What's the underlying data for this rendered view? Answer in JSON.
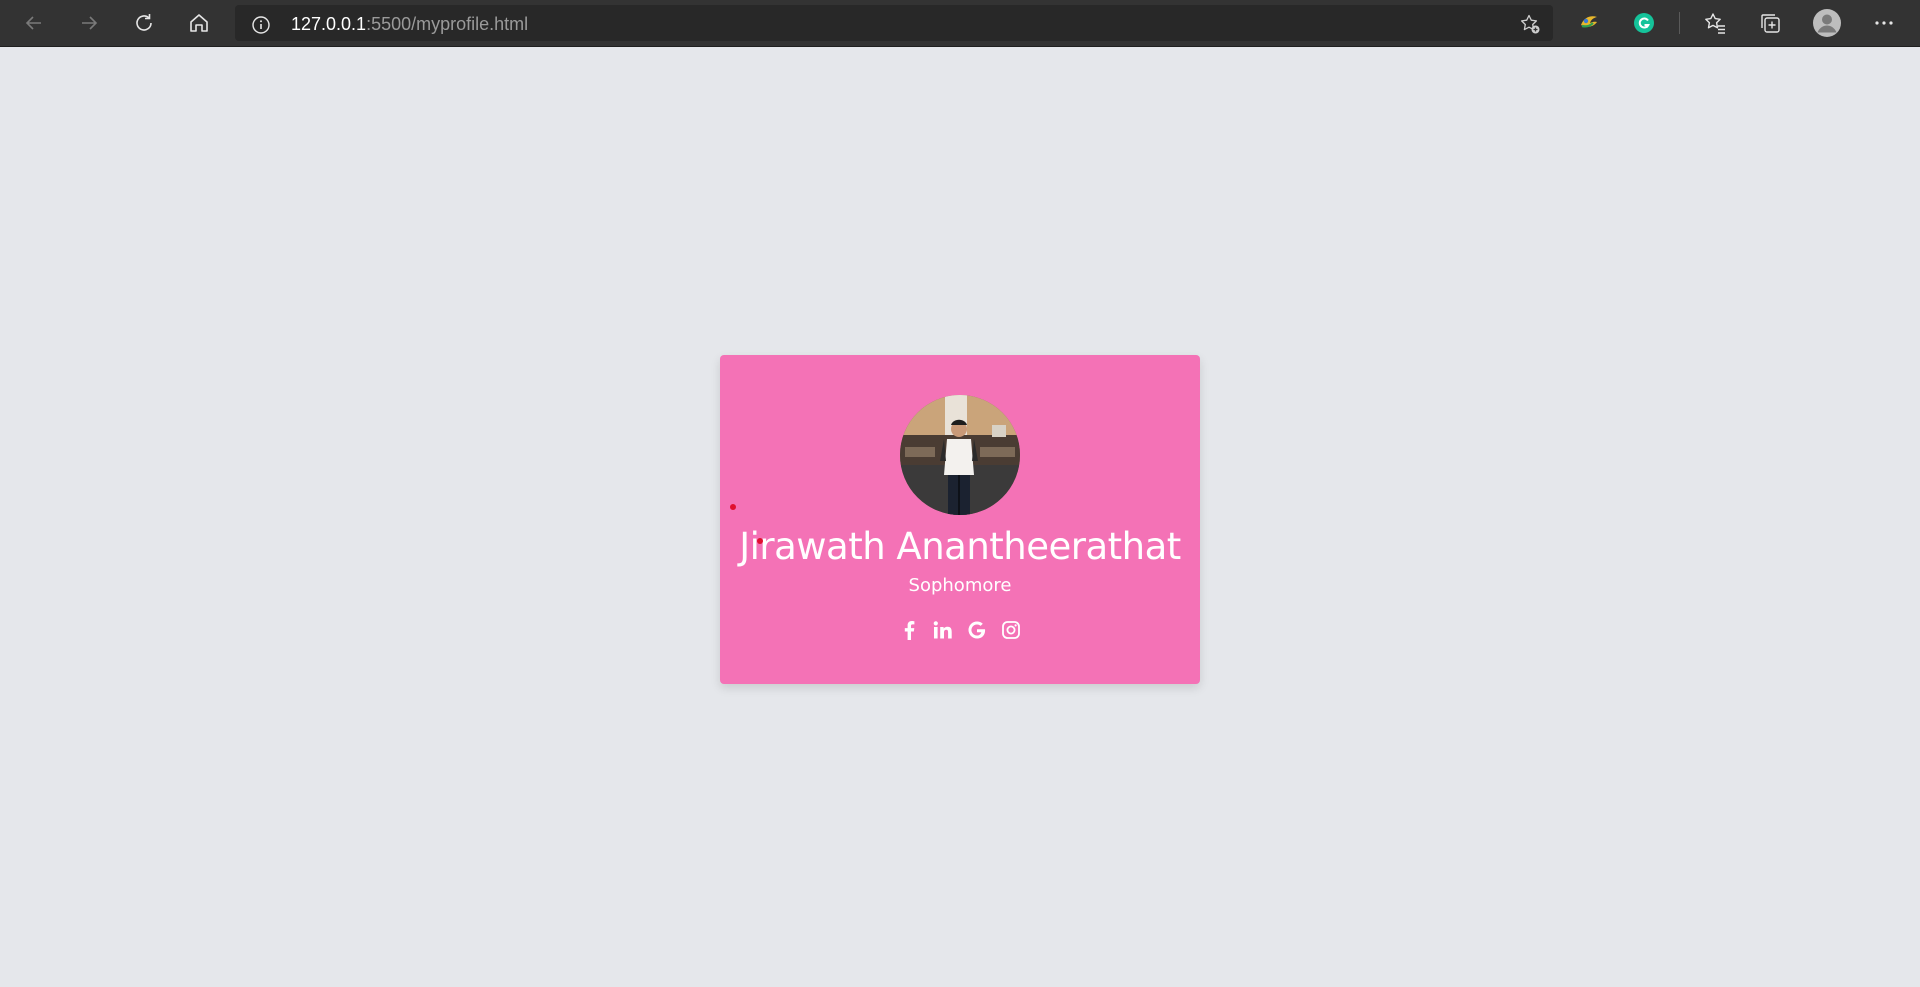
{
  "browser": {
    "url_host": "127.0.0.1",
    "url_rest": ":5500/myprofile.html",
    "nav_icons": [
      "back-icon",
      "forward-icon",
      "refresh-icon",
      "home-icon"
    ],
    "right_icons": [
      "extension-icon",
      "grammarly-icon",
      "favorites-icon",
      "collections-icon",
      "profile-icon",
      "more-icon"
    ]
  },
  "profile": {
    "name": "Jirawath Anantheerathat",
    "role": "Sophomore",
    "socials": [
      "facebook-icon",
      "linkedin-icon",
      "google-icon",
      "instagram-icon"
    ]
  },
  "colors": {
    "card": "#f472b6",
    "page_bg": "#e5e7eb",
    "toolbar": "#333333"
  }
}
